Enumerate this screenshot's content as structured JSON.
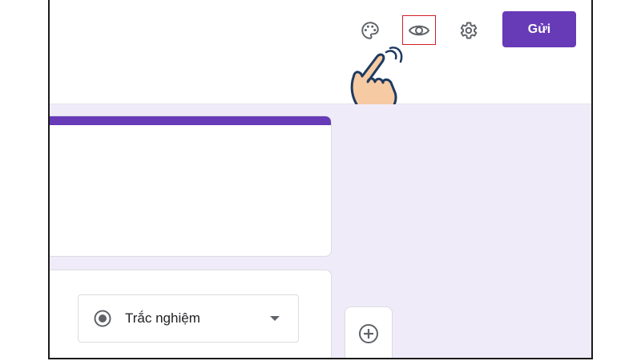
{
  "header": {
    "icons": {
      "palette": "palette-icon",
      "preview": "eye-icon",
      "settings": "gear-icon"
    },
    "send_label": "Gửi"
  },
  "question": {
    "type_label": "Trắc nghiệm",
    "type_icon": "radio-button-icon"
  },
  "toolbar": {
    "add_icon": "add-circle-icon"
  },
  "colors": {
    "accent": "#673ab7",
    "background": "#efebf8",
    "highlight_box": "#d21f27",
    "hand_fill": "#f6caa3",
    "hand_outline": "#1e3a5f"
  }
}
